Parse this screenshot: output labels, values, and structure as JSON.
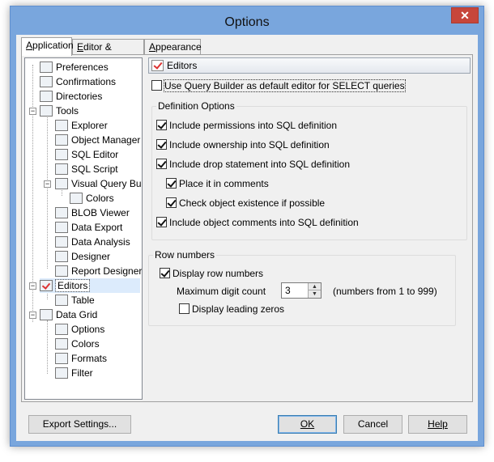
{
  "window": {
    "title": "Options",
    "close_glyph": "✕"
  },
  "tabs": [
    {
      "label_u": "A",
      "label_rest": "pplication",
      "active": true
    },
    {
      "label_pre": "",
      "label_u": "E",
      "label_rest": "ditor & Viewers",
      "active": false
    },
    {
      "label_u": "A",
      "label_rest": "ppearance",
      "active": false
    }
  ],
  "tree": {
    "items": [
      {
        "label": "Preferences",
        "icon": "preferences-icon"
      },
      {
        "label": "Confirmations",
        "icon": "confirmations-icon"
      },
      {
        "label": "Directories",
        "icon": "directories-icon"
      },
      {
        "label": "Tools",
        "icon": "tools-icon",
        "expander": "−"
      },
      {
        "label": "Explorer",
        "icon": "explorer-icon"
      },
      {
        "label": "Object Manager",
        "icon": "object-manager-icon"
      },
      {
        "label": "SQL Editor",
        "icon": "sql-editor-icon"
      },
      {
        "label": "SQL Script",
        "icon": "sql-script-icon"
      },
      {
        "label": "Visual Query Builder",
        "icon": "visual-query-builder-icon",
        "expander": "−"
      },
      {
        "label": "Colors",
        "icon": "colors-icon"
      },
      {
        "label": "BLOB Viewer",
        "icon": "blob-viewer-icon"
      },
      {
        "label": "Data Export",
        "icon": "data-export-icon"
      },
      {
        "label": "Data Analysis",
        "icon": "data-analysis-icon"
      },
      {
        "label": "Designer",
        "icon": "designer-icon"
      },
      {
        "label": "Report Designer",
        "icon": "report-designer-icon"
      },
      {
        "label": "Editors",
        "icon": "editors-icon",
        "expander": "−",
        "selected": true
      },
      {
        "label": "Table",
        "icon": "table-icon"
      },
      {
        "label": "Data Grid",
        "icon": "data-grid-icon",
        "expander": "−"
      },
      {
        "label": "Options",
        "icon": "options-icon"
      },
      {
        "label": "Colors",
        "icon": "colors-icon"
      },
      {
        "label": "Formats",
        "icon": "formats-icon"
      },
      {
        "label": "Filter",
        "icon": "filter-icon"
      }
    ]
  },
  "editors_panel": {
    "header": "Editors",
    "use_query_builder": {
      "label": "Use Query Builder as default editor for SELECT queries",
      "checked": false
    },
    "definition_options": {
      "title": "Definition Options",
      "items": [
        {
          "label": "Include permissions into SQL definition",
          "checked": true
        },
        {
          "label": "Include ownership into SQL definition",
          "checked": true
        },
        {
          "label": "Include drop statement into SQL definition",
          "checked": true
        },
        {
          "label": "Place it in comments",
          "checked": true
        },
        {
          "label": "Check object existence if possible",
          "checked": true
        },
        {
          "label": "Include object comments into SQL definition",
          "checked": true
        }
      ]
    },
    "row_numbers": {
      "title": "Row numbers",
      "display_row_numbers": {
        "label": "Display row numbers",
        "checked": true
      },
      "max_digit_label": "Maximum digit count",
      "max_digit_value": "3",
      "max_digit_hint": "(numbers from 1 to 999)",
      "display_leading_zeros": {
        "label": "Display leading zeros",
        "checked": false
      }
    }
  },
  "buttons": {
    "export_settings": "Export Settings...",
    "ok": "OK",
    "cancel": "Cancel",
    "help": "Help"
  }
}
